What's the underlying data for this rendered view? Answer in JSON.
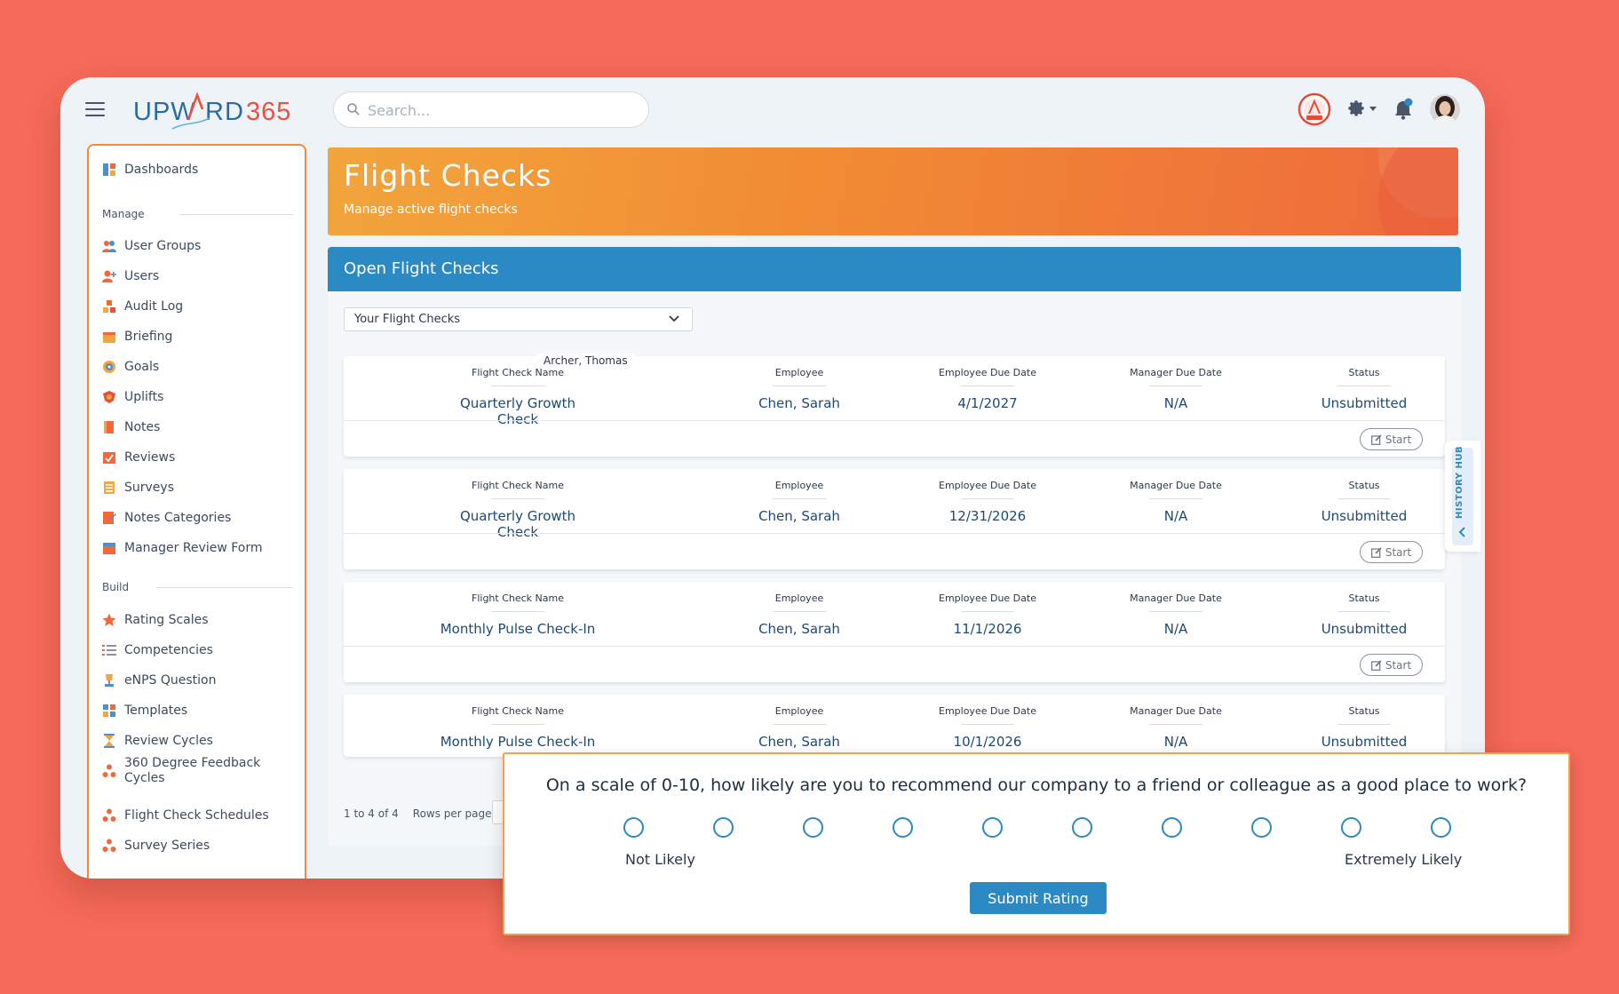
{
  "header": {
    "search_placeholder": "Search..."
  },
  "sidebar": {
    "top_item": "Dashboards",
    "manage_label": "Manage",
    "manage_items": [
      "User Groups",
      "Users",
      "Audit Log",
      "Briefing",
      "Goals",
      "Uplifts",
      "Notes",
      "Reviews",
      "Surveys",
      "Notes Categories",
      "Manager Review Form"
    ],
    "build_label": "Build",
    "build_items": [
      "Rating Scales",
      "Competencies",
      "eNPS Question",
      "Templates",
      "Review Cycles",
      "360 Degree Feedback Cycles",
      "Flight Check Schedules",
      "Survey Series"
    ]
  },
  "banner": {
    "title": "Flight Checks",
    "subtitle": "Manage active flight checks"
  },
  "panel": {
    "title": "Open Flight Checks",
    "filter_value": "Your Flight Checks",
    "columns": [
      "Flight Check Name",
      "Employee",
      "Employee Due Date",
      "Manager Due Date",
      "Status"
    ],
    "rows": [
      [
        "Quarterly Growth Check",
        "Chen, Sarah",
        "4/1/2027",
        "N/A",
        "Unsubmitted"
      ],
      [
        "Quarterly Growth Check",
        "Chen, Sarah",
        "12/31/2026",
        "N/A",
        "Unsubmitted"
      ],
      [
        "Monthly Pulse Check-In",
        "Chen, Sarah",
        "11/1/2026",
        "N/A",
        "Unsubmitted"
      ],
      [
        "Monthly Pulse Check-In",
        "Chen, Sarah",
        "10/1/2026",
        "N/A",
        "Unsubmitted"
      ]
    ],
    "start_label": "Start",
    "tooltip": "Archer, Thomas",
    "pagination": "1 to 4 of 4",
    "rows_per_page_label": "Rows per page:"
  },
  "history_hub": "HISTORY HUB",
  "enps": {
    "question": "On a scale of 0-10, how likely are you to recommend our company to a friend or colleague as a good place to work?",
    "low_label": "Not Likely",
    "high_label": "Extremely Likely",
    "submit_label": "Submit Rating"
  },
  "colors": {
    "background": "#f56a58",
    "accent_blue": "#2b8ac4",
    "accent_orange": "#f4893b",
    "text_navy": "#1e4972"
  }
}
